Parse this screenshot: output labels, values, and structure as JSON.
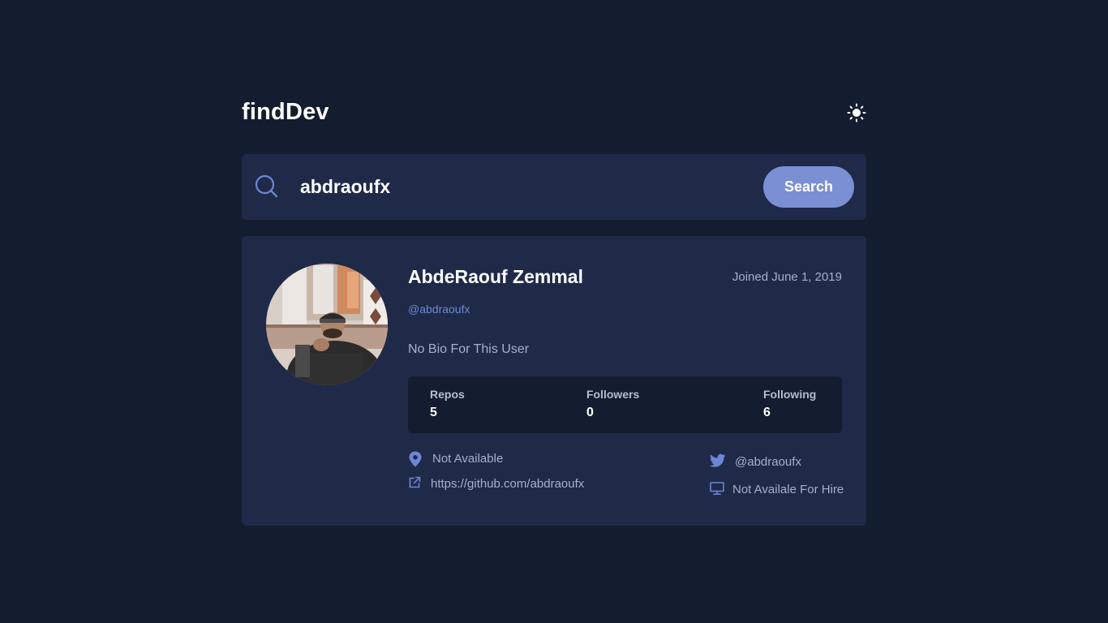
{
  "header": {
    "brand": "findDev",
    "theme_icon": "sun-icon"
  },
  "search": {
    "icon": "search-icon",
    "value": "abdraoufx",
    "placeholder": "",
    "button_label": "Search"
  },
  "profile": {
    "avatar_icon": "avatar",
    "name": "AbdeRaouf Zemmal",
    "joined": "Joined June 1, 2019",
    "login": "@abdraoufx",
    "bio": "No Bio For This User",
    "stats": {
      "repos_label": "Repos",
      "repos_value": "5",
      "followers_label": "Followers",
      "followers_value": "0",
      "following_label": "Following",
      "following_value": "6"
    },
    "location": "Not Available",
    "blog": "https://github.com/abdraoufx",
    "twitter": "@abdraoufx",
    "company": "Not Availale For Hire"
  },
  "colors": {
    "background": "#141c2f",
    "card": "#1f2a48",
    "accent": "#7b8fd4",
    "link": "#6e86d6",
    "muted_text": "#a7b0c7"
  }
}
